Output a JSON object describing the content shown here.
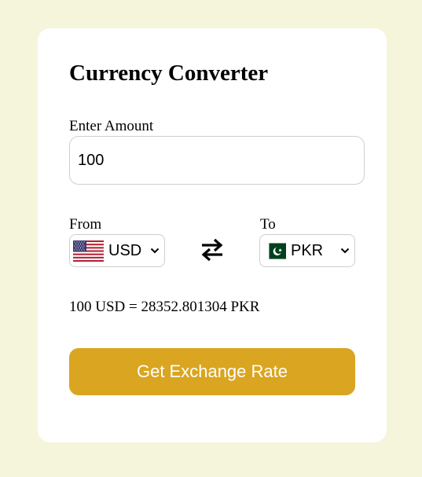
{
  "converter": {
    "title": "Currency Converter",
    "amount_label": "Enter Amount",
    "amount_value": "100",
    "from_label": "From",
    "to_label": "To",
    "from_currency": {
      "code": "USD",
      "flag_icon": "us-flag-icon"
    },
    "to_currency": {
      "code": "PKR",
      "flag_icon": "pk-flag-icon"
    },
    "swap_icon": "swap-arrows-icon",
    "result_text": "100 USD = 28352.801304 PKR",
    "button_label": "Get Exchange Rate"
  },
  "colors": {
    "page_background": "#f5f5dc",
    "card_background": "#ffffff",
    "button_background": "#daa520",
    "button_text": "#ffffff",
    "border": "#cfcfcf"
  }
}
